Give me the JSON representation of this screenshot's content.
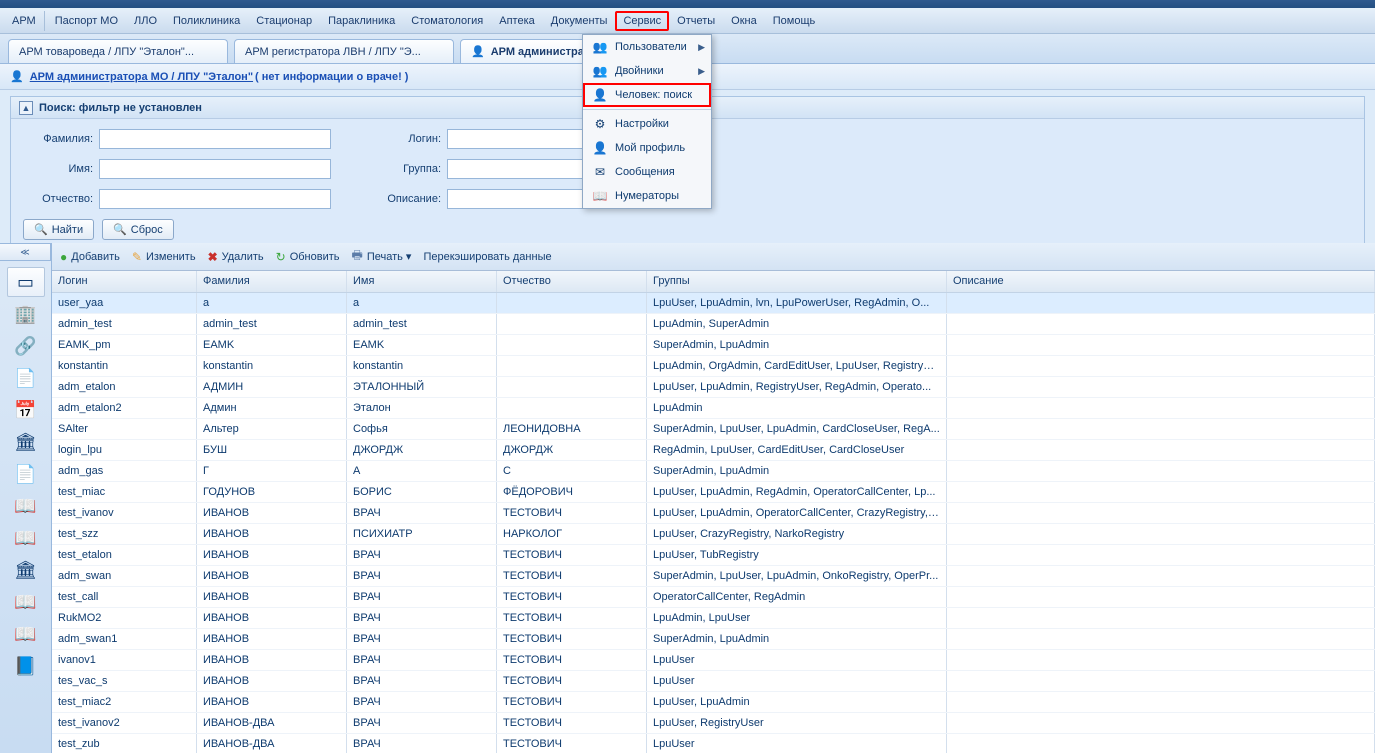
{
  "menubar": [
    "АРМ",
    "Паспорт МО",
    "ЛЛО",
    "Поликлиника",
    "Стационар",
    "Параклиника",
    "Стоматология",
    "Аптека",
    "Документы",
    "Сервис",
    "Отчеты",
    "Окна",
    "Помощь"
  ],
  "menubar_highlight_index": 9,
  "tabs": [
    {
      "label": "АРМ товароведа / ЛПУ \"Эталон\"...",
      "icon": ""
    },
    {
      "label": "АРМ регистратора ЛВН / ЛПУ \"Э...",
      "icon": ""
    },
    {
      "label": "АРМ администра...",
      "icon": "👤",
      "active": true
    }
  ],
  "crumb": {
    "icon": "👤",
    "link": "АРМ администратора МО / ЛПУ \"Эталон\"",
    "note": " ( нет информации о враче! )"
  },
  "search": {
    "title": "Поиск: фильтр не установлен",
    "labels": {
      "famil": "Фамилия:",
      "name": "Имя:",
      "patr": "Отчество:",
      "login": "Логин:",
      "group": "Группа:",
      "desc": "Описание:"
    },
    "values": {
      "famil": "",
      "name": "",
      "patr": "",
      "login": "",
      "group": "",
      "desc": ""
    },
    "btn_find": "Найти",
    "btn_reset": "Сброс"
  },
  "dropdown": [
    {
      "label": "Пользователи",
      "icon": "👥",
      "arrow": true
    },
    {
      "label": "Двойники",
      "icon": "👥",
      "arrow": true
    },
    {
      "label": "Человек: поиск",
      "icon": "👤",
      "highlight": true
    },
    {
      "sep": true
    },
    {
      "label": "Настройки",
      "icon": "⚙"
    },
    {
      "label": "Мой профиль",
      "icon": "👤"
    },
    {
      "label": "Сообщения",
      "icon": "✉"
    },
    {
      "label": "Нумераторы",
      "icon": "📖"
    }
  ],
  "toolbar": [
    {
      "label": "Добавить",
      "icon": "●",
      "cls": "add"
    },
    {
      "label": "Изменить",
      "icon": "✎",
      "cls": "edit"
    },
    {
      "label": "Удалить",
      "icon": "✖",
      "cls": "del"
    },
    {
      "label": "Обновить",
      "icon": "↻",
      "cls": "ref"
    },
    {
      "label": "Печать ▾",
      "icon": "🖶",
      "cls": "prn"
    },
    {
      "label": "Перекэшировать данные",
      "icon": "",
      "cls": ""
    }
  ],
  "grid": {
    "columns": [
      "Логин",
      "Фамилия",
      "Имя",
      "Отчество",
      "Группы",
      "Описание"
    ],
    "rows": [
      {
        "sel": true,
        "c": [
          "user_yaa",
          "a",
          "a",
          "",
          "LpuUser, LpuAdmin, lvn, LpuPowerUser, RegAdmin, O...",
          ""
        ]
      },
      {
        "c": [
          "admin_test",
          "admin_test",
          "admin_test",
          "",
          "LpuAdmin, SuperAdmin",
          ""
        ]
      },
      {
        "c": [
          "EAMK_pm",
          "EAMK",
          "EAMK",
          "",
          "SuperAdmin, LpuAdmin",
          ""
        ]
      },
      {
        "c": [
          "konstantin",
          "konstantin",
          "konstantin",
          "",
          "LpuAdmin, OrgAdmin, CardEditUser, LpuUser, RegistryU...",
          ""
        ]
      },
      {
        "c": [
          "adm_etalon",
          "АДМИН",
          "ЭТАЛОННЫЙ",
          "",
          "LpuUser, LpuAdmin, RegistryUser, RegAdmin, Operato...",
          ""
        ]
      },
      {
        "c": [
          "adm_etalon2",
          "Админ",
          "Эталон",
          "",
          "LpuAdmin",
          ""
        ]
      },
      {
        "c": [
          "SAlter",
          "Альтер",
          "Софья",
          "ЛЕОНИДОВНА",
          "SuperAdmin, LpuUser, LpuAdmin, CardCloseUser, RegA...",
          ""
        ]
      },
      {
        "c": [
          "login_lpu",
          "БУШ",
          "ДЖОРДЖ",
          "ДЖОРДЖ",
          "RegAdmin, LpuUser, CardEditUser, CardCloseUser",
          ""
        ]
      },
      {
        "c": [
          "adm_gas",
          "Г",
          "А",
          "С",
          "SuperAdmin, LpuAdmin",
          ""
        ]
      },
      {
        "c": [
          "test_miac",
          "ГОДУНОВ",
          "БОРИС",
          "ФЁДОРОВИЧ",
          "LpuUser, LpuAdmin, RegAdmin, OperatorCallCenter, Lp...",
          ""
        ]
      },
      {
        "c": [
          "test_ivanov",
          "ИВАНОВ",
          "ВРАЧ",
          "ТЕСТОВИЧ",
          "LpuUser, LpuAdmin, OperatorCallCenter, CrazyRegistry, ...",
          ""
        ]
      },
      {
        "c": [
          "test_szz",
          "ИВАНОВ",
          "ПСИХИАТР",
          "НАРКОЛОГ",
          "LpuUser, CrazyRegistry, NarkoRegistry",
          ""
        ]
      },
      {
        "c": [
          "test_etalon",
          "ИВАНОВ",
          "ВРАЧ",
          "ТЕСТОВИЧ",
          "LpuUser, TubRegistry",
          ""
        ]
      },
      {
        "c": [
          "adm_swan",
          "ИВАНОВ",
          "ВРАЧ",
          "ТЕСТОВИЧ",
          "SuperAdmin, LpuUser, LpuAdmin, OnkoRegistry, OperPr...",
          ""
        ]
      },
      {
        "c": [
          "test_call",
          "ИВАНОВ",
          "ВРАЧ",
          "ТЕСТОВИЧ",
          "OperatorCallCenter, RegAdmin",
          ""
        ]
      },
      {
        "c": [
          "RukMO2",
          "ИВАНОВ",
          "ВРАЧ",
          "ТЕСТОВИЧ",
          "LpuAdmin, LpuUser",
          ""
        ]
      },
      {
        "c": [
          "adm_swan1",
          "ИВАНОВ",
          "ВРАЧ",
          "ТЕСТОВИЧ",
          "SuperAdmin, LpuAdmin",
          ""
        ]
      },
      {
        "c": [
          "ivanov1",
          "ИВАНОВ",
          "ВРАЧ",
          "ТЕСТОВИЧ",
          "LpuUser",
          ""
        ]
      },
      {
        "c": [
          "tes_vac_s",
          "ИВАНОВ",
          "ВРАЧ",
          "ТЕСТОВИЧ",
          "LpuUser",
          ""
        ]
      },
      {
        "c": [
          "test_miac2",
          "ИВАНОВ",
          "ВРАЧ",
          "ТЕСТОВИЧ",
          "LpuUser, LpuAdmin",
          ""
        ]
      },
      {
        "c": [
          "test_ivanov2",
          "ИВАНОВ-ДВА",
          "ВРАЧ",
          "ТЕСТОВИЧ",
          "LpuUser, RegistryUser",
          ""
        ]
      },
      {
        "c": [
          "test_zub",
          "ИВАНОВ-ДВА",
          "ВРАЧ",
          "ТЕСТОВИЧ",
          "LpuUser",
          ""
        ]
      }
    ]
  },
  "side_icons": [
    "▭",
    "🏢",
    "🔗",
    "📄",
    "📅",
    "🏛",
    "📄",
    "📖",
    "📖",
    "🏛",
    "📖",
    "📖",
    "📘"
  ]
}
